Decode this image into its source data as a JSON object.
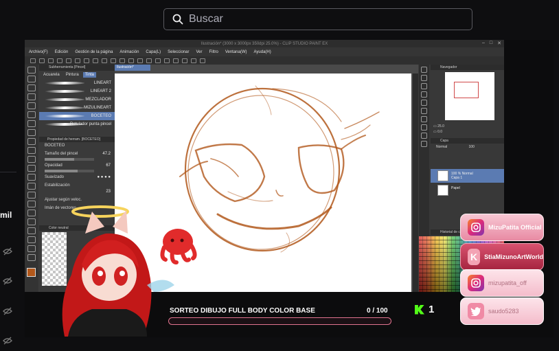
{
  "search": {
    "placeholder": "Buscar"
  },
  "sidebar": {
    "partial_text": "mil"
  },
  "csp": {
    "title": "Ilustración* (3000 x 3000px 350dpi 25.0%) - CLIP STUDIO PAINT EX",
    "menu": [
      "Archivo(F)",
      "Edición",
      "Gestión de la página",
      "Animación",
      "Capa(L)",
      "Seleccionar",
      "Ver",
      "Filtro",
      "Ventana(W)",
      "Ayuda(H)"
    ],
    "subtool_head": "Subherramienta [Pincel]",
    "subtool_tabs": [
      "Acuarela",
      "Pintura",
      "Tinta"
    ],
    "brushes": [
      "LINEART",
      "LINEART 2",
      "MEZCLADOR",
      "MIZULINEART",
      "BOCETEO",
      "Rotulador punta pincel"
    ],
    "tool_prop_head": "Propiedad de herram. [BOCETEO]",
    "tool_prop_name": "BOCETEO",
    "props": {
      "size_label": "Tamaño del pincel",
      "size_val": "47.2",
      "density_label": "Opacidad",
      "density_val": "67",
      "smooth_label": "Suavizado",
      "stabil_label": "Estabilización",
      "stabil_val": "23",
      "adjust_label": "Ajustar según veloc.",
      "vector_label": "Imán de vectores"
    },
    "color_head": "Color neutral",
    "canvas_tab": "Ilustración*",
    "navigator_head": "Navegador",
    "nav_zoom": "25.0",
    "nav_angle": "0.0",
    "layer_head": "Capa",
    "layer_blend": "Normal",
    "layer_opacity": "100",
    "layers": [
      {
        "line1": "100 % Normal",
        "line2": "Capa 1"
      },
      {
        "line1": "",
        "line2": "Papel"
      }
    ],
    "palette_head": "Historial de color"
  },
  "goal": {
    "title": "SORTEO DIBUJO FULL BODY COLOR BASE",
    "count": "0 / 100",
    "progress": 0
  },
  "kick": {
    "count": "1"
  },
  "socials": [
    {
      "label": "MizuPatita Official",
      "icon": "instagram-icon"
    },
    {
      "label": "StiaMizunoArtWorld",
      "icon": "kick-icon"
    },
    {
      "label": "mizupatita_off",
      "icon": "instagram-icon"
    },
    {
      "label": "saudo5283",
      "icon": "twitter-icon"
    }
  ],
  "colors": {
    "accent": "#e2738f",
    "csp_blue": "#5b7bb2",
    "sketch": "#b2581b",
    "kick": "#53fc18"
  }
}
